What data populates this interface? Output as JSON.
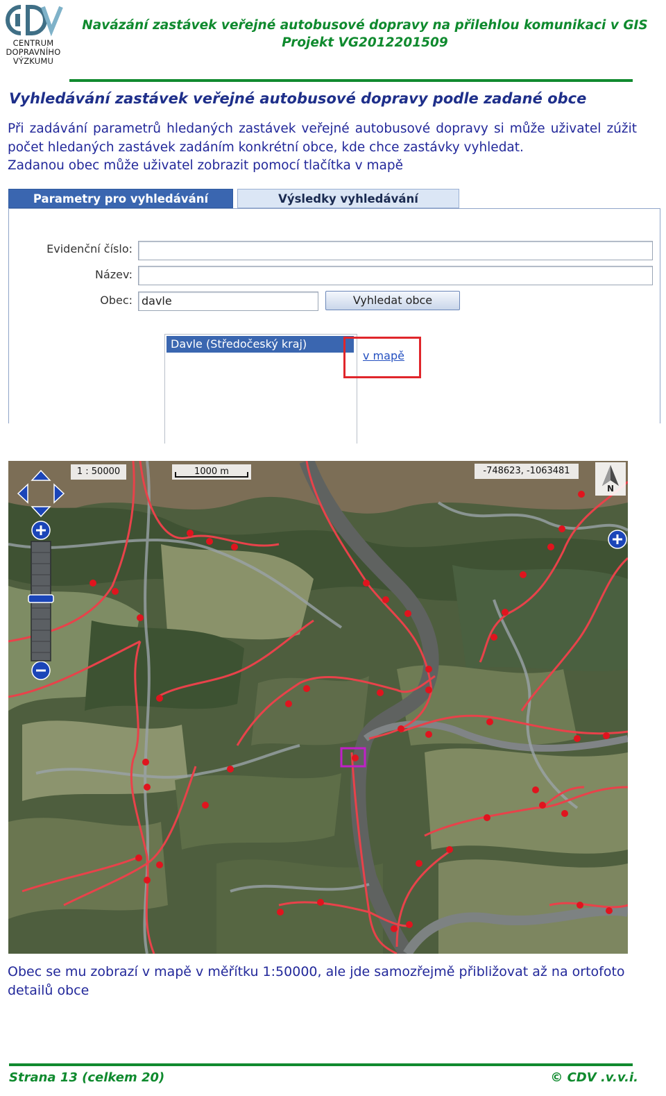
{
  "header": {
    "logo_text": [
      "CENTRUM",
      "DOPRAVNÍHO",
      "VÝZKUMU"
    ],
    "title_line1": "Navázání zastávek veřejné autobusové dopravy na přilehlou komunikaci v GIS",
    "title_line2": "Projekt VG2012201509",
    "accent_color": "#0f8a2e"
  },
  "section": {
    "heading": "Vyhledávání zastávek veřejné autobusové dopravy podle zadané obce",
    "para1": "Při zadávání parametrů hledaných zastávek veřejné autobusové dopravy si může uživatel zúžit počet hledaných zastávek zadáním konkrétní obce, kde chce zastávky vyhledat.",
    "para2": "Zadanou obec může uživatel zobrazit pomocí tlačítka v mapě"
  },
  "form": {
    "tab_active": "Parametry pro vyhledávání",
    "tab_inactive": "Výsledky vyhledávání",
    "label_evidencni": "Evidenční číslo:",
    "label_nazev": "Název:",
    "label_obec": "Obec:",
    "value_evidencni": "",
    "value_nazev": "",
    "value_obec": "davle",
    "button_vyhledat": "Vyhledat obce",
    "result_item": "Davle (Středočeský kraj)",
    "link_mapa": "v mapě"
  },
  "map": {
    "scale_text": "1 : 50000",
    "scalebar_text": "1000 m",
    "coordinates": "-748623, -1063481",
    "north_label": "N",
    "road_color": "#e8424a",
    "stop_color": "#e0141e",
    "highlight_color": "#c020c8"
  },
  "caption": "Obec se mu zobrazí v mapě v měřítku 1:50000, ale jde samozřejmě přibližovat až na ortofoto detailů obce",
  "footer": {
    "page": "Strana 13 (celkem 20)",
    "copyright": "© CDV .v.v.i."
  }
}
